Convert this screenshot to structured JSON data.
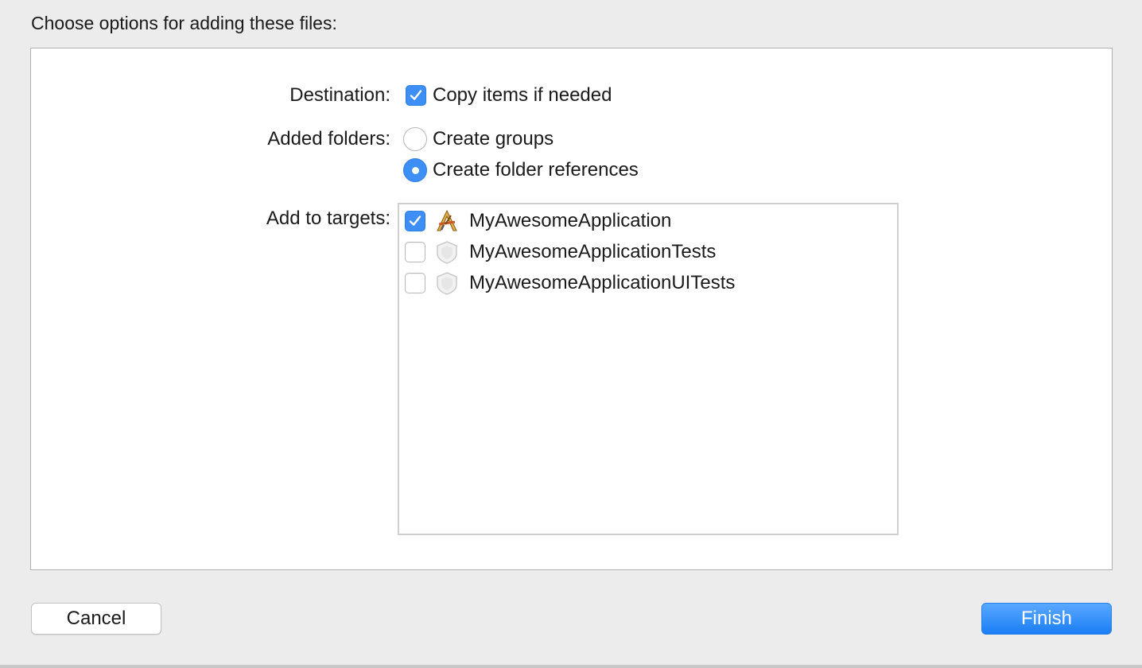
{
  "dialog": {
    "heading": "Choose options for adding these files:"
  },
  "destination": {
    "label": "Destination:",
    "option_label": "Copy items if needed",
    "checked": true
  },
  "added_folders": {
    "label": "Added folders:",
    "options": [
      {
        "label": "Create groups",
        "selected": false
      },
      {
        "label": "Create folder references",
        "selected": true
      }
    ]
  },
  "targets": {
    "label": "Add to targets:",
    "items": [
      {
        "name": "MyAwesomeApplication",
        "checked": true,
        "icon": "app-target-icon"
      },
      {
        "name": "MyAwesomeApplicationTests",
        "checked": false,
        "icon": "test-bundle-icon"
      },
      {
        "name": "MyAwesomeApplicationUITests",
        "checked": false,
        "icon": "test-bundle-icon"
      }
    ]
  },
  "buttons": {
    "cancel": "Cancel",
    "finish": "Finish"
  },
  "colors": {
    "accent": "#3d8ef5",
    "background": "#ececec"
  }
}
